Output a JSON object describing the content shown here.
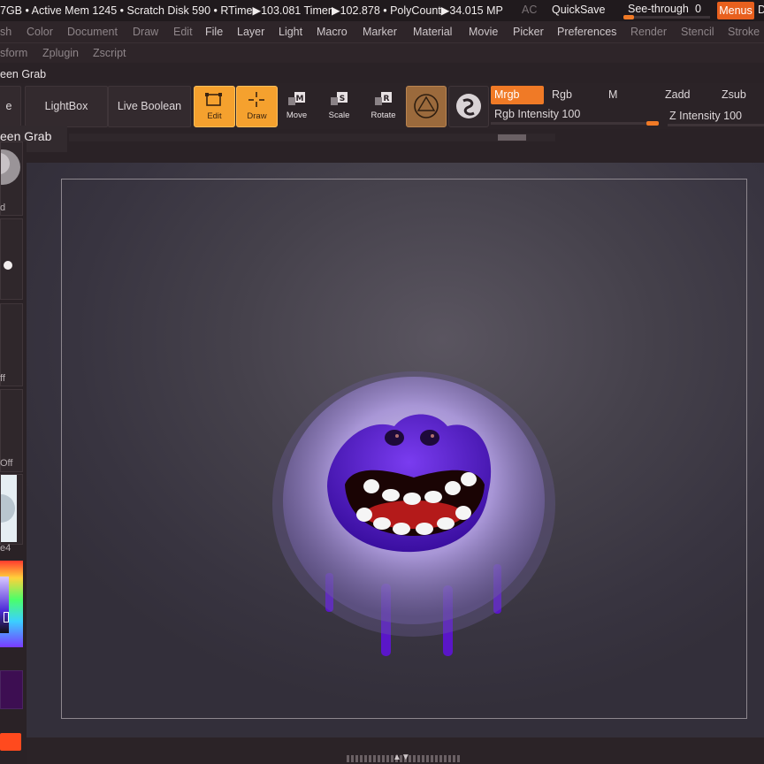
{
  "status_bar": {
    "text": "7GB • Active Mem 1245 • Scratch Disk 590 •  RTime▶103.081 Timer▶102.878 • PolyCount▶34.015 MP",
    "ac": "AC",
    "quicksave": "QuickSave",
    "see_through_label": "See-through",
    "see_through_value": "0",
    "see_through_level": 0,
    "menus_button": "Menus",
    "trailing_label": "D"
  },
  "menu_bar": {
    "items": [
      "sh",
      "Color",
      "Document",
      "Draw",
      "Edit",
      "File",
      "Layer",
      "Light",
      "Macro",
      "Marker",
      "Material",
      "Movie",
      "Picker",
      "Preferences",
      "Render",
      "Stencil",
      "Stroke"
    ],
    "items_row2": [
      "sform",
      "Zplugin",
      "Zscript"
    ]
  },
  "tool_label": "een Grab",
  "toolbar": {
    "partial_button": "e",
    "lightbox": "LightBox",
    "live_boolean": "Live Boolean",
    "modes": [
      {
        "label": "Edit",
        "active": true
      },
      {
        "label": "Draw",
        "active": true
      },
      {
        "label": "Move",
        "active": false,
        "key": "M"
      },
      {
        "label": "Scale",
        "active": false,
        "key": "S"
      },
      {
        "label": "Rotate",
        "active": false,
        "key": "R"
      }
    ],
    "material_icon": "material-sphere-icon",
    "color_mode": {
      "mrgb": "Mrgb",
      "rgb": "Rgb",
      "m": "M",
      "zadd": "Zadd",
      "zsub": "Zsub"
    },
    "rgb_intensity_label": "Rgb Intensity 100",
    "rgb_intensity": 100,
    "z_intensity_label": "Z Intensity 100",
    "z_intensity": 100
  },
  "screen_grab_label": "een Grab",
  "left_tray": {
    "labels": [
      "d",
      "ff",
      "Off",
      "e4"
    ]
  },
  "canvas": {
    "subject": "purple furry monster with open smiling mouth and four thin legs"
  },
  "colors": {
    "accent": "#f07a26",
    "active_mode": "#f5a12e",
    "monster_purple": "#5a16c8"
  }
}
